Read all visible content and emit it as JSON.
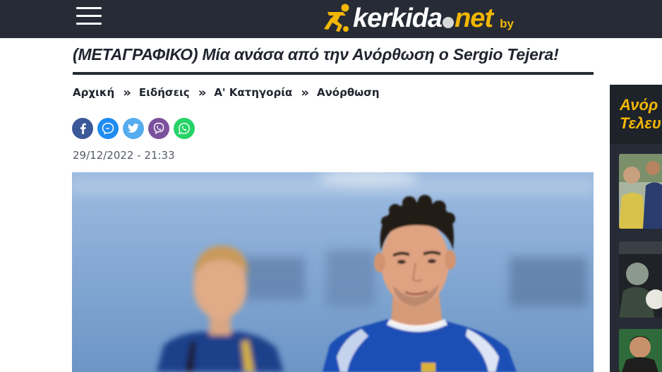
{
  "header": {
    "logo_text_main": "kerkida",
    "logo_text_net": "net",
    "logo_by": "by",
    "colors": {
      "bar": "#262b35",
      "accent": "#f2b705"
    },
    "menu_icon": "hamburger-menu-icon"
  },
  "article": {
    "title": "(ΜΕΤΑΓΡΑΦΙΚΟ) Μία ανάσα από την Ανόρθωση ο Sergio Tejera!",
    "date": "29/12/2022 - 21:33"
  },
  "breadcrumb": {
    "items": [
      "Αρχική",
      "Ειδήσεις",
      "Α' Κατηγορία",
      "Ανόρθωση"
    ],
    "separator": "»"
  },
  "share": [
    {
      "network": "facebook",
      "icon": "facebook-icon",
      "color": "#3b5998"
    },
    {
      "network": "messenger",
      "icon": "messenger-icon",
      "color": "#1f8bf0"
    },
    {
      "network": "twitter",
      "icon": "twitter-icon",
      "color": "#55acee"
    },
    {
      "network": "viber",
      "icon": "viber-icon",
      "color": "#7b519d"
    },
    {
      "network": "whatsapp",
      "icon": "whatsapp-icon",
      "color": "#25d366"
    }
  ],
  "sidebar": {
    "heading_line1": "Ανόρ",
    "heading_line2": "Τελευ"
  }
}
